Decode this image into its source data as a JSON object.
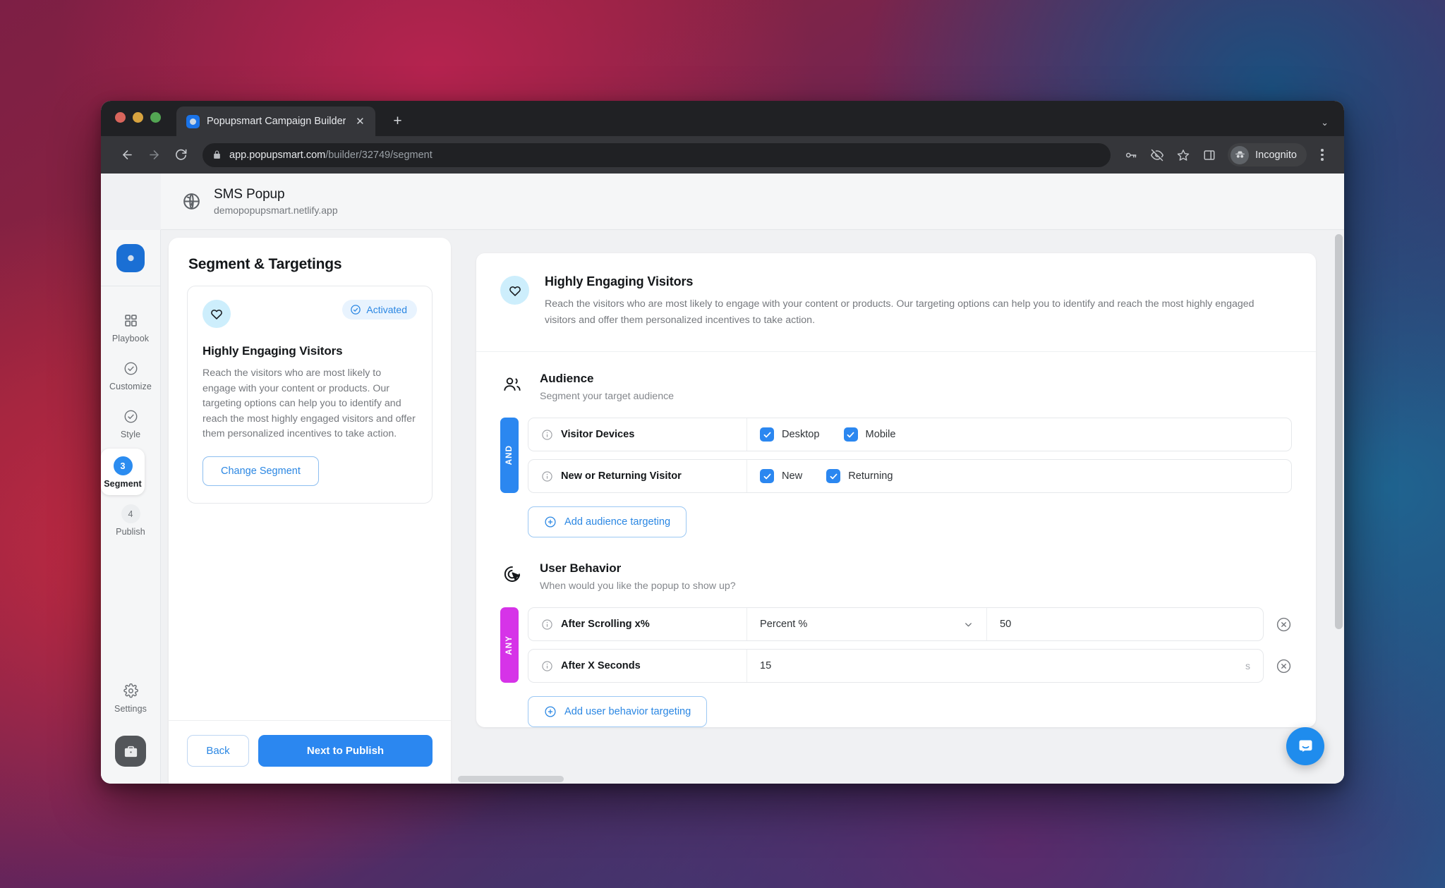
{
  "browser": {
    "tab": {
      "title": "Popupsmart Campaign Builder",
      "favicon_icon": "popupsmart-favicon",
      "close_icon": "close-icon"
    },
    "new_tab_icon": "plus-icon",
    "tab_list_chevron_icon": "chevron-down-icon",
    "nav": {
      "back_icon": "arrow-left-icon",
      "forward_icon": "arrow-right-icon",
      "reload_icon": "reload-icon"
    },
    "omnibox": {
      "lock_icon": "lock-icon",
      "url_domain": "app.popupsmart.com",
      "url_path": "/builder/32749/segment"
    },
    "toolbar_icons": [
      "key-icon",
      "eye-off-icon",
      "star-icon",
      "side-panel-icon"
    ],
    "profile": {
      "label": "Incognito",
      "avatar_icon": "incognito-icon"
    },
    "menu_icon": "kebab-menu-icon"
  },
  "appbar": {
    "globe_icon": "globe-icon",
    "title": "SMS Popup",
    "subtitle": "demopopupsmart.netlify.app"
  },
  "rail": {
    "logo_icon": "popupsmart-logo",
    "items": [
      {
        "label": "Playbook",
        "icon": "grid-icon",
        "state": "default"
      },
      {
        "label": "Customize",
        "icon": "check-circle-icon",
        "state": "complete"
      },
      {
        "label": "Style",
        "icon": "check-circle-icon",
        "state": "complete"
      },
      {
        "label": "Segment",
        "step": "3",
        "state": "active"
      },
      {
        "label": "Publish",
        "step": "4",
        "state": "default"
      }
    ],
    "settings": {
      "label": "Settings",
      "icon": "gear-icon"
    },
    "workspace_icon": "briefcase-icon"
  },
  "panel": {
    "title": "Segment & Targetings",
    "segment_card": {
      "icon": "heart-icon",
      "status_label": "Activated",
      "status_icon": "check-circle-icon",
      "name": "Highly Engaging Visitors",
      "description": "Reach the visitors who are most likely to engage with your content or products. Our targeting options can help you to identify and reach the most highly engaged visitors and offer them personalized incentives to take action.",
      "change_label": "Change Segment"
    },
    "footer": {
      "back_label": "Back",
      "next_label": "Next to Publish"
    }
  },
  "main": {
    "hero": {
      "icon": "heart-icon",
      "title": "Highly Engaging Visitors",
      "description": "Reach the visitors who are most likely to engage with your content or products. Our targeting options can help you to identify and reach the most highly engaged visitors and offer them personalized incentives to take action."
    },
    "audience": {
      "icon": "people-icon",
      "title": "Audience",
      "subtitle": "Segment your target audience",
      "logic": "AND",
      "logic_color": "#2b87f0",
      "rules": [
        {
          "info_icon": "info-icon",
          "label": "Visitor Devices",
          "options": [
            {
              "label": "Desktop",
              "checked": true
            },
            {
              "label": "Mobile",
              "checked": true
            }
          ]
        },
        {
          "info_icon": "info-icon",
          "label": "New or Returning Visitor",
          "options": [
            {
              "label": "New",
              "checked": true
            },
            {
              "label": "Returning",
              "checked": true
            }
          ]
        }
      ],
      "add_label": "Add audience targeting",
      "add_icon": "plus-circle-icon"
    },
    "user_behavior": {
      "icon": "cursor-click-icon",
      "title": "User Behavior",
      "subtitle": "When would you like the popup to show up?",
      "logic": "ANY",
      "logic_color": "#d633e8",
      "rules": [
        {
          "info_icon": "info-icon",
          "label": "After Scrolling x%",
          "select_value": "Percent %",
          "select_icon": "chevron-down-icon",
          "input_value": "50",
          "unit": "",
          "delete_icon": "remove-circle-icon"
        },
        {
          "info_icon": "info-icon",
          "label": "After X Seconds",
          "select_value": "",
          "input_value": "15",
          "unit": "s",
          "delete_icon": "remove-circle-icon"
        }
      ],
      "add_label": "Add user behavior targeting",
      "add_icon": "plus-circle-icon"
    }
  },
  "widgets": {
    "chat_icon": "intercom-chat-icon"
  },
  "colors": {
    "accent": "#2b87f0",
    "logic_any": "#d633e8",
    "status_bg": "#e8f3fe",
    "icon_bg": "#cdeefc"
  }
}
